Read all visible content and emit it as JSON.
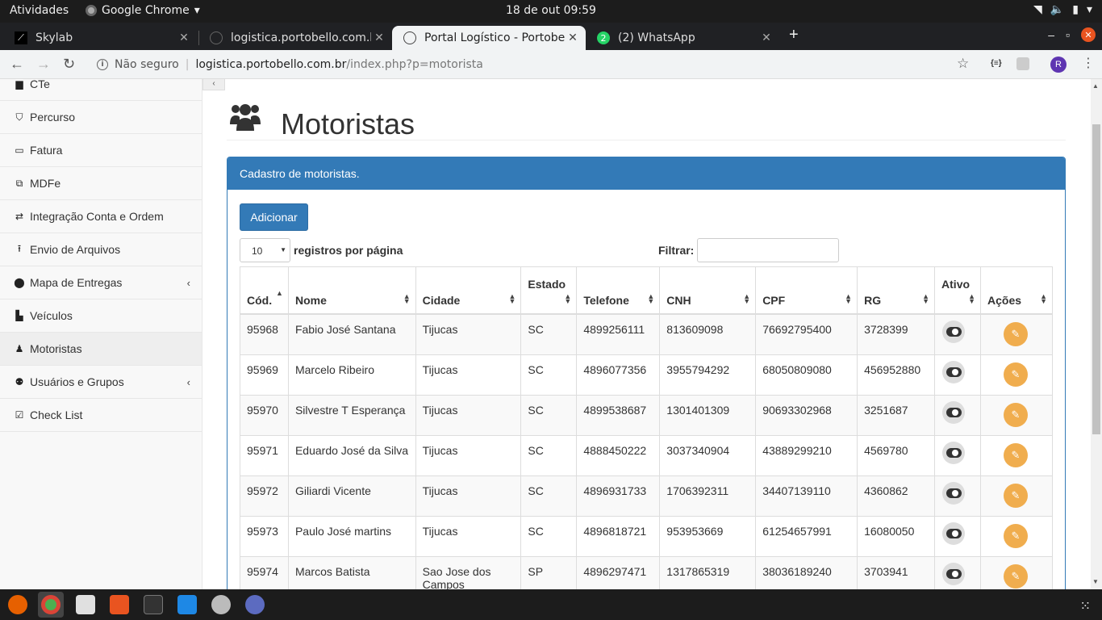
{
  "topbar": {
    "activities": "Atividades",
    "app_name": "Google Chrome",
    "clock": "18 de out  09:59"
  },
  "tabs": [
    {
      "title": "Skylab",
      "active": false
    },
    {
      "title": "logistica.portobello.com.br",
      "active": false
    },
    {
      "title": "Portal Logístico - Portobello",
      "active": true
    },
    {
      "title": "(2) WhatsApp",
      "active": false
    }
  ],
  "omnibox": {
    "security": "Não seguro",
    "host": "logistica.portobello.com.br",
    "path": "/index.php?p=motorista"
  },
  "profile_initial": "R",
  "sidebar": {
    "items": [
      {
        "label": "CTe",
        "icon": "file-icon"
      },
      {
        "label": "Percurso",
        "icon": "road-icon"
      },
      {
        "label": "Fatura",
        "icon": "money-icon"
      },
      {
        "label": "MDFe",
        "icon": "copy-icon"
      },
      {
        "label": "Integração Conta e Ordem",
        "icon": "exchange-icon"
      },
      {
        "label": "Envio de Arquivos",
        "icon": "upload-icon"
      },
      {
        "label": "Mapa de Entregas",
        "icon": "map-marker-icon",
        "has_children": true
      },
      {
        "label": "Veículos",
        "icon": "truck-icon"
      },
      {
        "label": "Motoristas",
        "icon": "male-icon",
        "active": true
      },
      {
        "label": "Usuários e Grupos",
        "icon": "users-icon",
        "has_children": true
      },
      {
        "label": "Check List",
        "icon": "check-square-icon"
      }
    ]
  },
  "page": {
    "title": "Motoristas",
    "panel_heading": "Cadastro de motoristas.",
    "add_button": "Adicionar",
    "per_page_value": "10",
    "per_page_label": "registros por página",
    "filter_label": "Filtrar:"
  },
  "table": {
    "columns": [
      "Cód.",
      "Nome",
      "Cidade",
      "Estado",
      "Telefone",
      "CNH",
      "CPF",
      "RG",
      "Ativo",
      "Ações"
    ],
    "rows": [
      {
        "cod": "95968",
        "nome": "Fabio José Santana",
        "cidade": "Tijucas",
        "estado": "SC",
        "telefone": "4899256111",
        "cnh": "813609098",
        "cpf": "76692795400",
        "rg": "3728399",
        "ativo": true
      },
      {
        "cod": "95969",
        "nome": "Marcelo Ribeiro",
        "cidade": "Tijucas",
        "estado": "SC",
        "telefone": "4896077356",
        "cnh": "3955794292",
        "cpf": "68050809080",
        "rg": "456952880",
        "ativo": true
      },
      {
        "cod": "95970",
        "nome": "Silvestre T Esperança",
        "cidade": "Tijucas",
        "estado": "SC",
        "telefone": "4899538687",
        "cnh": "1301401309",
        "cpf": "90693302968",
        "rg": "3251687",
        "ativo": true
      },
      {
        "cod": "95971",
        "nome": "Eduardo José da Silva",
        "cidade": "Tijucas",
        "estado": "SC",
        "telefone": "4888450222",
        "cnh": "3037340904",
        "cpf": "43889299210",
        "rg": "4569780",
        "ativo": true
      },
      {
        "cod": "95972",
        "nome": "Giliardi Vicente",
        "cidade": "Tijucas",
        "estado": "SC",
        "telefone": "4896931733",
        "cnh": "1706392311",
        "cpf": "34407139110",
        "rg": "4360862",
        "ativo": true
      },
      {
        "cod": "95973",
        "nome": "Paulo José martins",
        "cidade": "Tijucas",
        "estado": "SC",
        "telefone": "4896818721",
        "cnh": "953953669",
        "cpf": "61254657991",
        "rg": "16080050",
        "ativo": true
      },
      {
        "cod": "95974",
        "nome": "Marcos Batista",
        "cidade": "Sao Jose dos Campos",
        "estado": "SP",
        "telefone": "4896297471",
        "cnh": "1317865319",
        "cpf": "38036189240",
        "rg": "3703941",
        "ativo": true
      }
    ]
  },
  "colors": {
    "primary": "#337ab7",
    "warning": "#f0ad4e",
    "topbar": "#1c1c1c",
    "tabstrip": "#202124"
  }
}
